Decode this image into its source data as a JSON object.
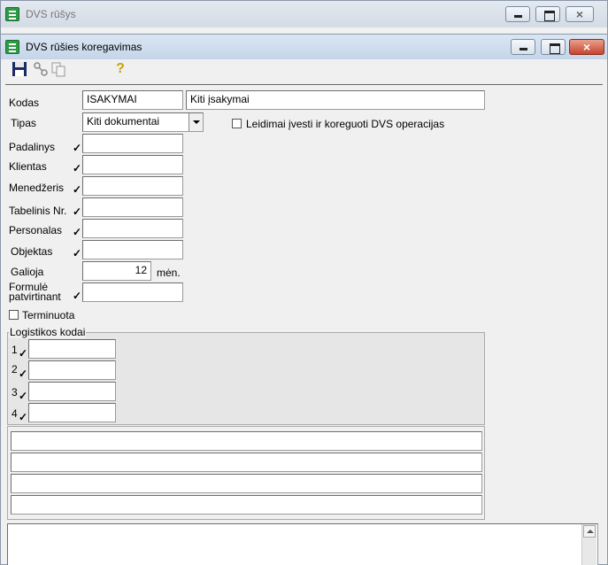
{
  "back_window": {
    "title": "DVS rūšys"
  },
  "window": {
    "title": "DVS rūšies koregavimas"
  },
  "toolbar": {
    "icons": [
      "save-icon",
      "tools-icon",
      "copy-icon",
      "help-icon"
    ],
    "help_glyph": "?"
  },
  "form": {
    "kodas": {
      "label": "Kodas",
      "code": "ISAKYMAI",
      "name": "Kiti įsakymai"
    },
    "tipas": {
      "label": "Tipas",
      "value": "Kiti dokumentai"
    },
    "permit": {
      "label": "Leidimai įvesti ir koreguoti DVS operacijas",
      "checked": false
    },
    "check_glyph": "✓",
    "padalinys": {
      "label": "Padalinys",
      "value": ""
    },
    "klientas": {
      "label": "Klientas",
      "value": ""
    },
    "menedzeris": {
      "label": "Menedžeris",
      "value": ""
    },
    "tabelinis": {
      "label": "Tabelinis Nr.",
      "value": ""
    },
    "personalas": {
      "label": "Personalas",
      "value": ""
    },
    "objektas": {
      "label": "Objektas",
      "value": ""
    },
    "galioja": {
      "label": "Galioja",
      "value": "12",
      "unit": "mėn."
    },
    "formule": {
      "label_line1": "Formulė",
      "label_line2": "patvirtinant",
      "value": ""
    },
    "terminuota": {
      "label": "Terminuota",
      "checked": false
    }
  },
  "logistics": {
    "legend": "Logistikos kodai",
    "rows": [
      {
        "num": "1",
        "value": ""
      },
      {
        "num": "2",
        "value": ""
      },
      {
        "num": "3",
        "value": ""
      },
      {
        "num": "4",
        "value": ""
      }
    ]
  },
  "text_lines": [
    "",
    "",
    "",
    ""
  ],
  "notes": {
    "value": ""
  }
}
